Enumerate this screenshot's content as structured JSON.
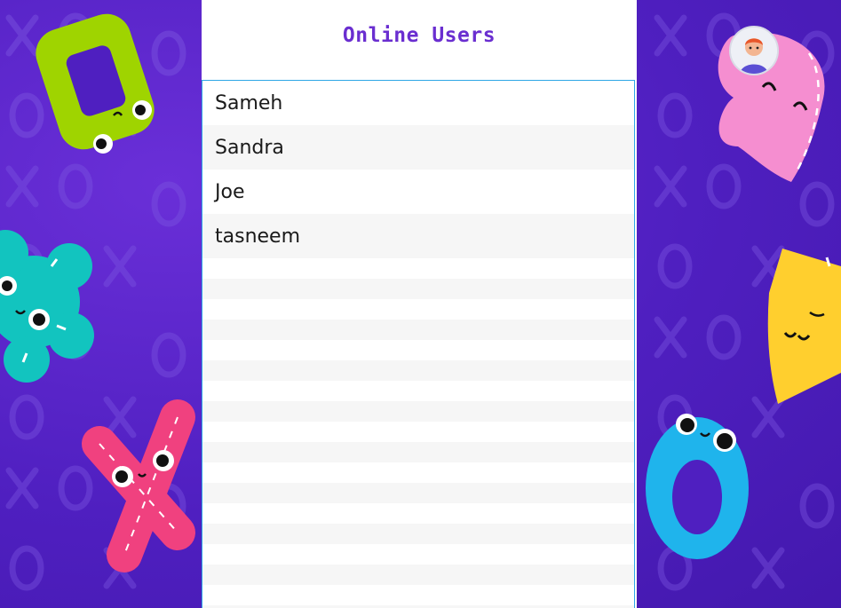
{
  "header": {
    "title": "Online Users"
  },
  "users": [
    {
      "name": "Sameh"
    },
    {
      "name": "Sandra"
    },
    {
      "name": "Joe"
    },
    {
      "name": "tasneem"
    }
  ],
  "colors": {
    "background": "#4f1fc0",
    "title": "#6a2ed0",
    "list_border": "#2ea7e6",
    "row_alt": "#f6f6f6"
  },
  "decor": {
    "left": [
      "green-diamond-character",
      "teal-flower-character",
      "pink-x-character"
    ],
    "right": [
      "pink-heart-character",
      "yellow-triangle-character",
      "blue-ring-character"
    ],
    "pattern": "x-o-pattern"
  },
  "avatar": {
    "icon": "user-avatar-icon"
  }
}
